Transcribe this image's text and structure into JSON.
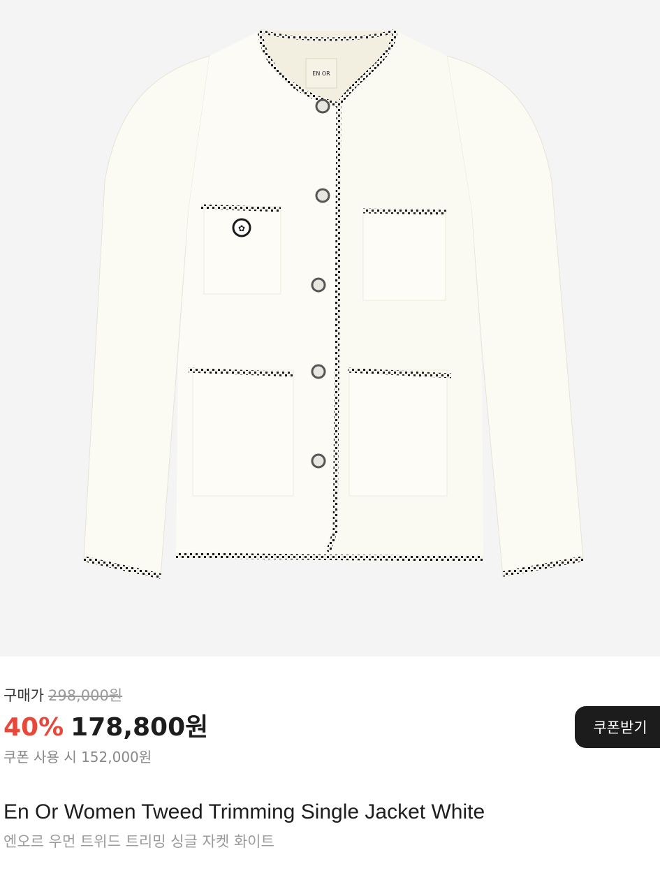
{
  "product_image": {
    "icon": "tweed-jacket-image",
    "label_text": "EN OR"
  },
  "price": {
    "label": "구매가",
    "original": "298,000원",
    "discount": "40%",
    "sale": "178,800원",
    "coupon_price": "쿠폰 사용 시 152,000원"
  },
  "coupon_button": {
    "label": "쿠폰받기"
  },
  "product": {
    "name_en": "En Or Women Tweed Trimming Single Jacket White",
    "name_ko": "엔오르 우먼 트위드 트리밍 싱글 자켓 화이트"
  },
  "colors": {
    "discount": "#e8483a",
    "button_bg": "#1c1c1c",
    "hero_bg": "#f4f4f4"
  }
}
